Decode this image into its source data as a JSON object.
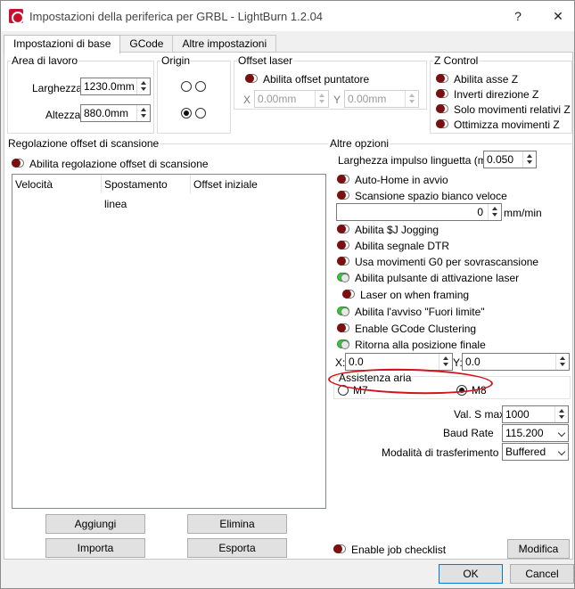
{
  "window": {
    "title": "Impostazioni della periferica per GRBL - LightBurn 1.2.04",
    "help": "?",
    "close": "✕"
  },
  "tabs": [
    "Impostazioni di base",
    "GCode",
    "Altre impostazioni"
  ],
  "work_area": {
    "title": "Area di lavoro",
    "width_label": "Larghezza",
    "width_value": "1230.0mm",
    "height_label": "Altezza",
    "height_value": "880.0mm"
  },
  "origin": {
    "title": "Origin"
  },
  "offset_laser": {
    "title": "Offset laser",
    "enable_label": "Abilita offset puntatore",
    "x_label": "X",
    "x_value": "0.00mm",
    "y_label": "Y",
    "y_value": "0.00mm"
  },
  "z_control": {
    "title": "Z Control",
    "items": [
      "Abilita asse Z",
      "Inverti direzione Z",
      "Solo movimenti relativi Z",
      "Ottimizza movimenti Z"
    ]
  },
  "scan_offset": {
    "title": "Regolazione offset di scansione",
    "enable_label": "Abilita regolazione offset di scansione",
    "columns": [
      "Velocità",
      "Spostamento linea",
      "Offset iniziale"
    ],
    "buttons": {
      "add": "Aggiungi",
      "delete": "Elimina",
      "import": "Importa",
      "export": "Esporta"
    }
  },
  "other": {
    "title": "Altre opzioni",
    "tab_width_label": "Larghezza impulso linguetta (mm)",
    "tab_width_value": "0.050",
    "auto_home": "Auto-Home in avvio",
    "fast_white": "Scansione spazio bianco veloce",
    "fast_white_value": "0",
    "fast_white_unit": "mm/min",
    "jogging": "Abilita $J Jogging",
    "dtr": "Abilita segnale DTR",
    "g0_overscan": "Usa movimenti G0 per sovrascansione",
    "fire_button": "Abilita pulsante di attivazione laser",
    "laser_framing": "Laser on when framing",
    "out_of_bounds": "Abilita l'avviso \"Fuori limite\"",
    "gcode_clustering": "Enable GCode Clustering",
    "return_position": "Ritorna alla posizione finale",
    "x_label": "X:",
    "x_value": "0.0",
    "y_label": "Y:",
    "y_value": "0.0",
    "air_assist": {
      "title": "Assistenza aria",
      "m7": "M7",
      "m8": "M8"
    },
    "s_max_label": "Val. S max",
    "s_max_value": "1000",
    "baud_label": "Baud Rate",
    "baud_value": "115.200",
    "transfer_label": "Modalità di trasferimento",
    "transfer_value": "Buffered",
    "job_checklist": "Enable job checklist",
    "modify": "Modifica"
  },
  "footer": {
    "ok": "OK",
    "cancel": "Cancel"
  },
  "colors": {
    "toggle_off": "#7a1010",
    "toggle_on": "#3cc43c",
    "annotation": "#d0141c"
  }
}
